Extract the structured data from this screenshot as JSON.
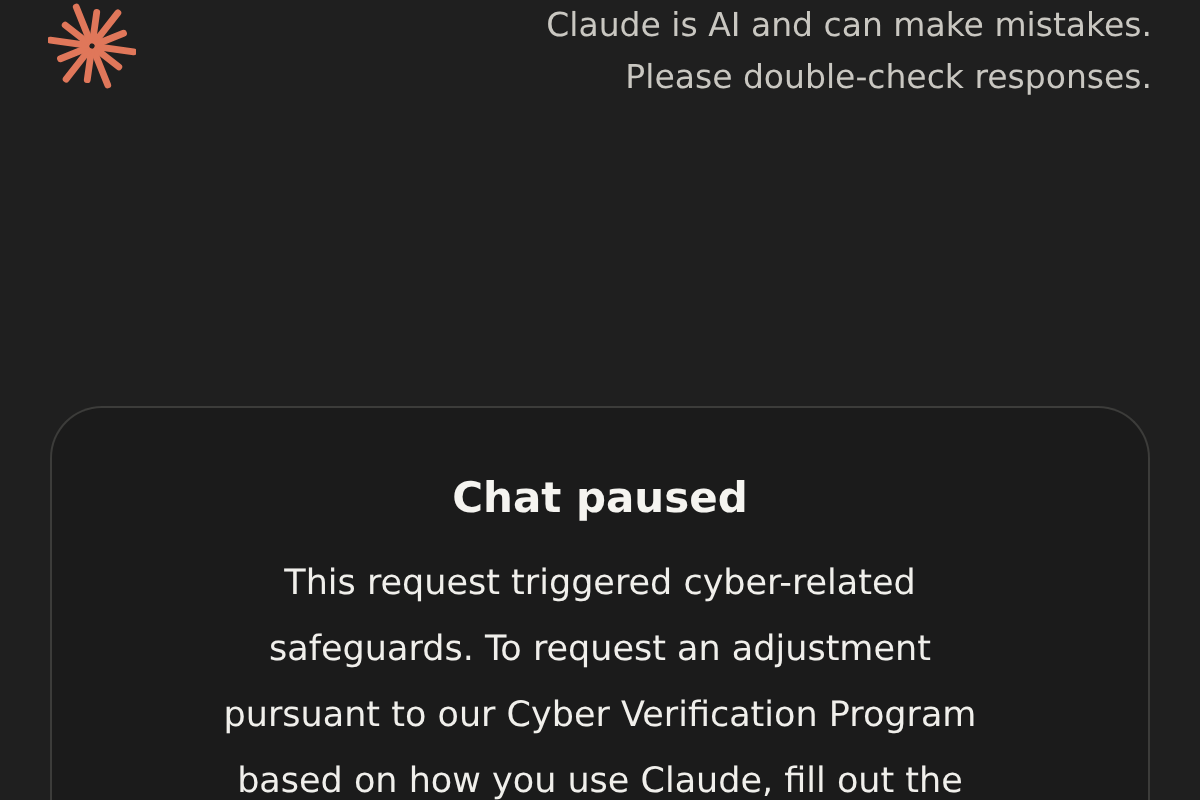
{
  "header": {
    "disclaimer_lines": [
      "Claude is AI and can make mistakes.",
      "Please double-check responses."
    ]
  },
  "notice": {
    "title": "Chat paused",
    "body_lines": [
      "This request triggered cyber-related",
      "safeguards. To request an adjustment",
      "pursuant to our Cyber Verification Program",
      "based on how you use Claude, fill out the"
    ]
  }
}
